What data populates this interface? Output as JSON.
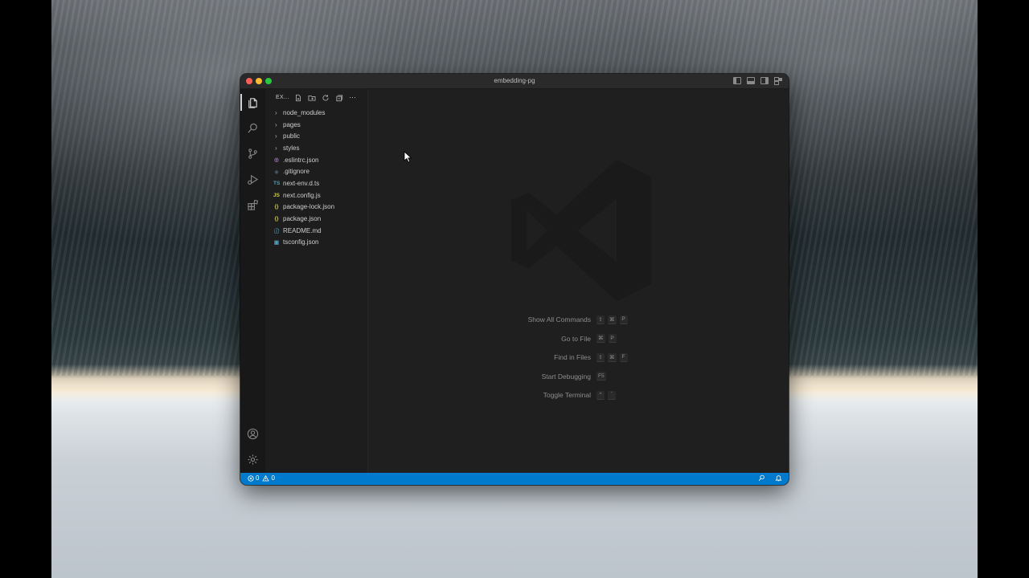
{
  "window": {
    "title": "embedding-pg"
  },
  "explorer": {
    "title": "EX...",
    "folders": [
      "node_modules",
      "pages",
      "public",
      "styles"
    ],
    "files": [
      {
        "name": ".eslintrc.json",
        "icon": "eslint-icon",
        "glyph": "◎",
        "color": "#a074c4"
      },
      {
        "name": ".gitignore",
        "icon": "git-icon",
        "glyph": "◆",
        "color": "#41535b"
      },
      {
        "name": "next-env.d.ts",
        "icon": "typescript-icon",
        "glyph": "TS",
        "color": "#519aba"
      },
      {
        "name": "next.config.js",
        "icon": "javascript-icon",
        "glyph": "JS",
        "color": "#cbcb41"
      },
      {
        "name": "package-lock.json",
        "icon": "json-icon",
        "glyph": "{}",
        "color": "#cbcb41"
      },
      {
        "name": "package.json",
        "icon": "json-icon",
        "glyph": "{}",
        "color": "#cbcb41"
      },
      {
        "name": "README.md",
        "icon": "info-icon",
        "glyph": "ⓘ",
        "color": "#519aba"
      },
      {
        "name": "tsconfig.json",
        "icon": "tsconfig-icon",
        "glyph": "▣",
        "color": "#519aba"
      }
    ]
  },
  "shortcuts": [
    {
      "label": "Show All Commands",
      "keys": [
        "⇧",
        "⌘",
        "P"
      ]
    },
    {
      "label": "Go to File",
      "keys": [
        "⌘",
        "P"
      ]
    },
    {
      "label": "Find in Files",
      "keys": [
        "⇧",
        "⌘",
        "F"
      ]
    },
    {
      "label": "Start Debugging",
      "keys": [
        "F5"
      ]
    },
    {
      "label": "Toggle Terminal",
      "keys": [
        "^",
        "`"
      ]
    }
  ],
  "status": {
    "errors": "0",
    "warnings": "0"
  },
  "colors": {
    "status_bar": "#007acc",
    "editor_bg": "#1f1f1f",
    "sidebar_bg": "#1d1d1d"
  }
}
